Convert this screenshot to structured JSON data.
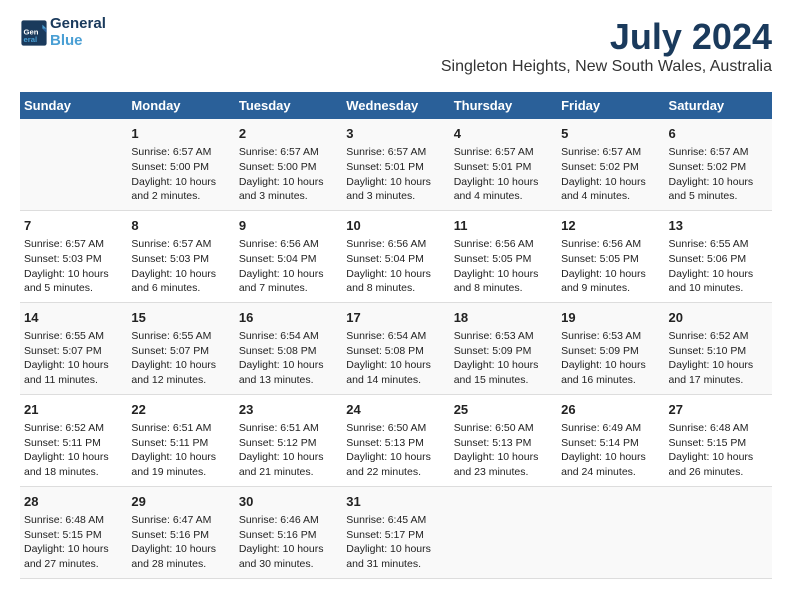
{
  "logo": {
    "text_general": "General",
    "text_blue": "Blue"
  },
  "title": "July 2024",
  "subtitle": "Singleton Heights, New South Wales, Australia",
  "days_header": [
    "Sunday",
    "Monday",
    "Tuesday",
    "Wednesday",
    "Thursday",
    "Friday",
    "Saturday"
  ],
  "weeks": [
    [
      {
        "day": "",
        "info": ""
      },
      {
        "day": "1",
        "info": "Sunrise: 6:57 AM\nSunset: 5:00 PM\nDaylight: 10 hours\nand 2 minutes."
      },
      {
        "day": "2",
        "info": "Sunrise: 6:57 AM\nSunset: 5:00 PM\nDaylight: 10 hours\nand 3 minutes."
      },
      {
        "day": "3",
        "info": "Sunrise: 6:57 AM\nSunset: 5:01 PM\nDaylight: 10 hours\nand 3 minutes."
      },
      {
        "day": "4",
        "info": "Sunrise: 6:57 AM\nSunset: 5:01 PM\nDaylight: 10 hours\nand 4 minutes."
      },
      {
        "day": "5",
        "info": "Sunrise: 6:57 AM\nSunset: 5:02 PM\nDaylight: 10 hours\nand 4 minutes."
      },
      {
        "day": "6",
        "info": "Sunrise: 6:57 AM\nSunset: 5:02 PM\nDaylight: 10 hours\nand 5 minutes."
      }
    ],
    [
      {
        "day": "7",
        "info": "Sunrise: 6:57 AM\nSunset: 5:03 PM\nDaylight: 10 hours\nand 5 minutes."
      },
      {
        "day": "8",
        "info": "Sunrise: 6:57 AM\nSunset: 5:03 PM\nDaylight: 10 hours\nand 6 minutes."
      },
      {
        "day": "9",
        "info": "Sunrise: 6:56 AM\nSunset: 5:04 PM\nDaylight: 10 hours\nand 7 minutes."
      },
      {
        "day": "10",
        "info": "Sunrise: 6:56 AM\nSunset: 5:04 PM\nDaylight: 10 hours\nand 8 minutes."
      },
      {
        "day": "11",
        "info": "Sunrise: 6:56 AM\nSunset: 5:05 PM\nDaylight: 10 hours\nand 8 minutes."
      },
      {
        "day": "12",
        "info": "Sunrise: 6:56 AM\nSunset: 5:05 PM\nDaylight: 10 hours\nand 9 minutes."
      },
      {
        "day": "13",
        "info": "Sunrise: 6:55 AM\nSunset: 5:06 PM\nDaylight: 10 hours\nand 10 minutes."
      }
    ],
    [
      {
        "day": "14",
        "info": "Sunrise: 6:55 AM\nSunset: 5:07 PM\nDaylight: 10 hours\nand 11 minutes."
      },
      {
        "day": "15",
        "info": "Sunrise: 6:55 AM\nSunset: 5:07 PM\nDaylight: 10 hours\nand 12 minutes."
      },
      {
        "day": "16",
        "info": "Sunrise: 6:54 AM\nSunset: 5:08 PM\nDaylight: 10 hours\nand 13 minutes."
      },
      {
        "day": "17",
        "info": "Sunrise: 6:54 AM\nSunset: 5:08 PM\nDaylight: 10 hours\nand 14 minutes."
      },
      {
        "day": "18",
        "info": "Sunrise: 6:53 AM\nSunset: 5:09 PM\nDaylight: 10 hours\nand 15 minutes."
      },
      {
        "day": "19",
        "info": "Sunrise: 6:53 AM\nSunset: 5:09 PM\nDaylight: 10 hours\nand 16 minutes."
      },
      {
        "day": "20",
        "info": "Sunrise: 6:52 AM\nSunset: 5:10 PM\nDaylight: 10 hours\nand 17 minutes."
      }
    ],
    [
      {
        "day": "21",
        "info": "Sunrise: 6:52 AM\nSunset: 5:11 PM\nDaylight: 10 hours\nand 18 minutes."
      },
      {
        "day": "22",
        "info": "Sunrise: 6:51 AM\nSunset: 5:11 PM\nDaylight: 10 hours\nand 19 minutes."
      },
      {
        "day": "23",
        "info": "Sunrise: 6:51 AM\nSunset: 5:12 PM\nDaylight: 10 hours\nand 21 minutes."
      },
      {
        "day": "24",
        "info": "Sunrise: 6:50 AM\nSunset: 5:13 PM\nDaylight: 10 hours\nand 22 minutes."
      },
      {
        "day": "25",
        "info": "Sunrise: 6:50 AM\nSunset: 5:13 PM\nDaylight: 10 hours\nand 23 minutes."
      },
      {
        "day": "26",
        "info": "Sunrise: 6:49 AM\nSunset: 5:14 PM\nDaylight: 10 hours\nand 24 minutes."
      },
      {
        "day": "27",
        "info": "Sunrise: 6:48 AM\nSunset: 5:15 PM\nDaylight: 10 hours\nand 26 minutes."
      }
    ],
    [
      {
        "day": "28",
        "info": "Sunrise: 6:48 AM\nSunset: 5:15 PM\nDaylight: 10 hours\nand 27 minutes."
      },
      {
        "day": "29",
        "info": "Sunrise: 6:47 AM\nSunset: 5:16 PM\nDaylight: 10 hours\nand 28 minutes."
      },
      {
        "day": "30",
        "info": "Sunrise: 6:46 AM\nSunset: 5:16 PM\nDaylight: 10 hours\nand 30 minutes."
      },
      {
        "day": "31",
        "info": "Sunrise: 6:45 AM\nSunset: 5:17 PM\nDaylight: 10 hours\nand 31 minutes."
      },
      {
        "day": "",
        "info": ""
      },
      {
        "day": "",
        "info": ""
      },
      {
        "day": "",
        "info": ""
      }
    ]
  ]
}
